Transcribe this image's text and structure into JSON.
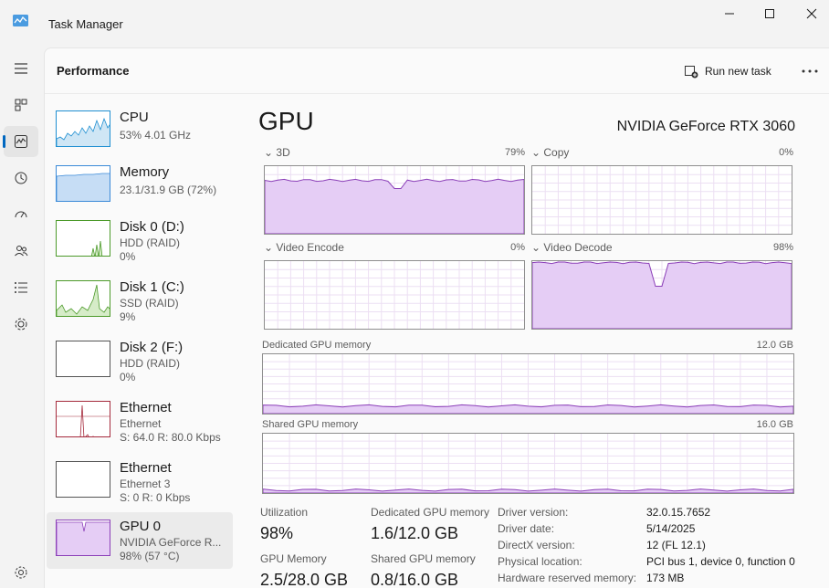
{
  "window": {
    "title": "Task Manager"
  },
  "header": {
    "title": "Performance",
    "run_new_task": "Run new task"
  },
  "rail": [
    "hamburger",
    "processes",
    "performance",
    "app-history",
    "startup",
    "users",
    "details",
    "services",
    "settings"
  ],
  "devices": [
    {
      "name": "CPU",
      "sub1": "53%  4.01 GHz",
      "sub2": "",
      "sub3": "",
      "color": "#1f8fd1"
    },
    {
      "name": "Memory",
      "sub1": "23.1/31.9 GB (72%)",
      "sub2": "",
      "sub3": "",
      "color": "#3b8ad8"
    },
    {
      "name": "Disk 0 (D:)",
      "sub1": "HDD (RAID)",
      "sub2": "0%",
      "sub3": "",
      "color": "#4c9a2a"
    },
    {
      "name": "Disk 1 (C:)",
      "sub1": "SSD (RAID)",
      "sub2": "9%",
      "sub3": "",
      "color": "#4c9a2a"
    },
    {
      "name": "Disk 2 (F:)",
      "sub1": "HDD (RAID)",
      "sub2": "0%",
      "sub3": "",
      "color": "#4c9a2a"
    },
    {
      "name": "Ethernet",
      "sub1": "Ethernet",
      "sub2": "S: 64.0  R: 80.0 Kbps",
      "sub3": "",
      "color": "#a52a3c"
    },
    {
      "name": "Ethernet",
      "sub1": "Ethernet 3",
      "sub2": "S: 0  R: 0 Kbps",
      "sub3": "",
      "color": "#a52a3c"
    },
    {
      "name": "GPU 0",
      "sub1": "NVIDIA GeForce R...",
      "sub2": "98%  (57 °C)",
      "sub3": "",
      "color": "#8b3fb8"
    }
  ],
  "gpu": {
    "title": "GPU",
    "model": "NVIDIA GeForce RTX 3060",
    "engines": [
      {
        "name": "3D",
        "pct": "79%",
        "level": 0.79
      },
      {
        "name": "Copy",
        "pct": "0%",
        "level": 0.0
      },
      {
        "name": "Video Encode",
        "pct": "0%",
        "level": 0.0
      },
      {
        "name": "Video Decode",
        "pct": "98%",
        "level": 0.98
      }
    ],
    "dedicated": {
      "label": "Dedicated GPU memory",
      "max": "12.0 GB",
      "level": 0.13
    },
    "shared": {
      "label": "Shared GPU memory",
      "max": "16.0 GB",
      "level": 0.05
    },
    "stats": {
      "utilization_label": "Utilization",
      "utilization": "98%",
      "dedicated_label": "Dedicated GPU memory",
      "dedicated": "1.6/12.0 GB",
      "gpu_memory_label": "GPU Memory",
      "gpu_memory": "2.5/28.0 GB",
      "shared_label": "Shared GPU memory",
      "shared": "0.8/16.0 GB"
    },
    "info": [
      {
        "k": "Driver version:",
        "v": "32.0.15.7652"
      },
      {
        "k": "Driver date:",
        "v": "5/14/2025"
      },
      {
        "k": "DirectX version:",
        "v": "12 (FL 12.1)"
      },
      {
        "k": "Physical location:",
        "v": "PCI bus 1, device 0, function 0"
      },
      {
        "k": "Hardware reserved memory:",
        "v": "173 MB"
      }
    ]
  },
  "colors": {
    "gpu_line": "#8b3fb8",
    "gpu_fill": "#e5cdf5",
    "accent": "#0067c0"
  }
}
